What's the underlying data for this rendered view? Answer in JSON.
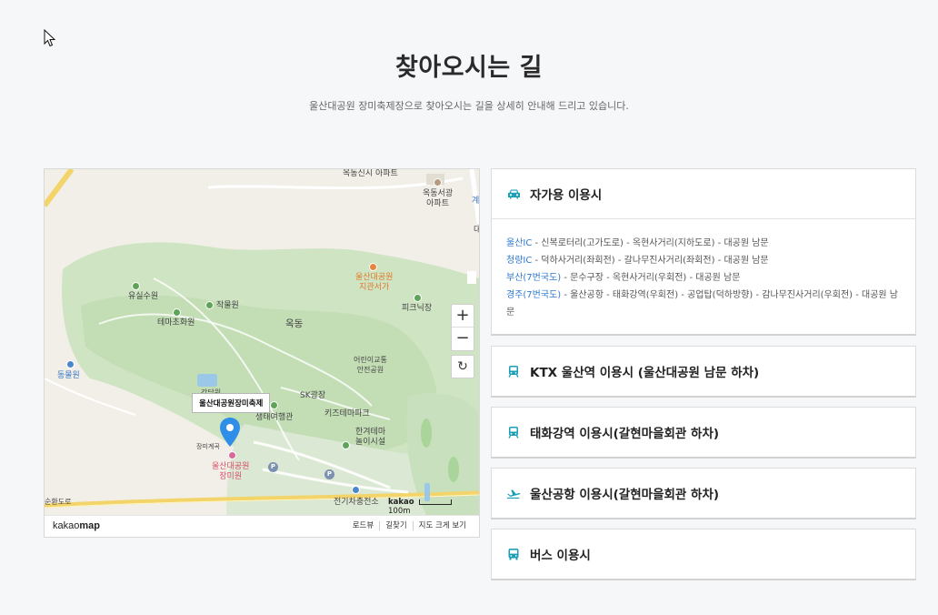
{
  "header": {
    "title": "찾아오시는 길",
    "subtitle": "울산대공원 장미축제장으로 찾아오시는 길을 상세히 안내해 드리고 있습니다."
  },
  "map": {
    "marker_label": "울산대공원장미축제",
    "labels": {
      "okdong_sinsi": "옥동신시\n아파트",
      "okdong_seogwang": "옥동서광\n아파트",
      "yusilsuwon": "유실수원",
      "jakmulwon": "작물원",
      "temachowon": "테마초화원",
      "okdong": "옥동",
      "picnic": "피크닉장",
      "donggwon": "동물원",
      "jigwan": "울산대공원\n지관서가",
      "sk": "SK광장",
      "children": "어린이교통\n안전공원",
      "saengtae": "생태여행관",
      "kids": "키즈테마파크",
      "haneul": "한겨테마\n놀이시설",
      "rose_garden": "울산대공원\n장미원",
      "rose_sub": "장미계곡",
      "charging": "전기차충전소",
      "road": "순환도로",
      "gye": "계",
      "dae": "대",
      "gangdang": "강당원"
    },
    "scale_text": "100m",
    "kakao_mark": "kakao",
    "zoom_in": "+",
    "zoom_out": "−",
    "reset": "↻",
    "footer": {
      "logo_light": "kakao",
      "logo_bold": "map",
      "links": [
        "로드뷰",
        "길찾기",
        "지도 크게 보기"
      ]
    }
  },
  "sections": [
    {
      "icon": "car-icon",
      "title": "자가용 이용시",
      "expanded": true,
      "routes": [
        {
          "start": "울산IC",
          "rest": " - 신복로터리(고가도로) - 옥현사거리(지하도로) - 대공원 남문"
        },
        {
          "start": "청량IC",
          "rest": " - 덕하사거리(좌회전) - 갈나무진사거리(좌회전) - 대공원 남문"
        },
        {
          "start": "부산(7번국도)",
          "rest": " - 문수구장 - 옥현사거리(우회전) - 대공원 남문"
        },
        {
          "start": "경주(7번국도)",
          "rest": " - 울산공항 - 태화강역(우회전) - 공업탑(덕하방향) - 감나무진사거리(우회전) - 대공원 남문"
        }
      ]
    },
    {
      "icon": "train-icon",
      "title": "KTX 울산역 이용시 (울산대공원 남문 하차)",
      "expanded": false
    },
    {
      "icon": "train-icon",
      "title": "태화강역 이용시(갈현마을회관 하차)",
      "expanded": false
    },
    {
      "icon": "airplane-icon",
      "title": "울산공항 이용시(갈현마을회관 하차)",
      "expanded": false
    },
    {
      "icon": "bus-icon",
      "title": "버스 이용시",
      "expanded": false
    }
  ],
  "colors": {
    "accent": "#2e7ad1",
    "icon": "#1a9fb5",
    "marker": "#2f8fe8"
  }
}
